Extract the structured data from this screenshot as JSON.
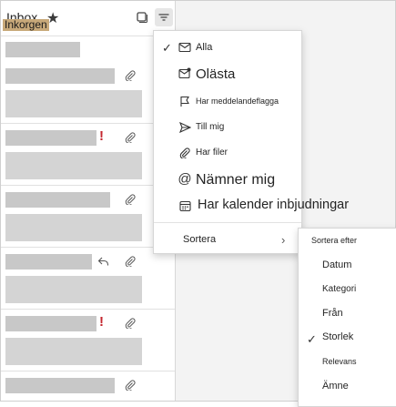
{
  "header": {
    "title": "Inbox",
    "title_overlay": "Inkorgen"
  },
  "filter_menu": {
    "items": [
      {
        "label": "Alla",
        "icon": "mail-icon",
        "checked": true
      },
      {
        "label": "Olästa",
        "icon": "unread-mail-icon",
        "checked": false
      },
      {
        "label": "Har meddelandeflagga",
        "icon": "flag-icon",
        "checked": false
      },
      {
        "label": "Till mig",
        "icon": "send-arrow-icon",
        "checked": false
      },
      {
        "label": "Har filer",
        "icon": "paperclip-icon",
        "checked": false
      },
      {
        "label": "Nämner mig",
        "icon": "at-sign-icon",
        "checked": false
      },
      {
        "label": "Har kalender inbjudningar",
        "icon": "calendar-icon",
        "checked": false
      }
    ],
    "sort_label": "Sortera"
  },
  "sort_submenu": {
    "header": "Sortera efter",
    "items": [
      {
        "label": "Datum",
        "checked": false
      },
      {
        "label": "Kategori",
        "checked": false
      },
      {
        "label": "Från",
        "checked": false
      },
      {
        "label": "Storlek",
        "checked": true
      },
      {
        "label": "Relevans",
        "checked": false
      },
      {
        "label": "Ämne",
        "checked": false
      }
    ]
  },
  "mail_items": [
    {
      "flagged": false,
      "replied": false,
      "attachment": true
    },
    {
      "flagged": true,
      "replied": false,
      "attachment": true
    },
    {
      "flagged": false,
      "replied": false,
      "attachment": true
    },
    {
      "flagged": false,
      "replied": true,
      "attachment": true
    },
    {
      "flagged": true,
      "replied": false,
      "attachment": true
    },
    {
      "flagged": false,
      "replied": false,
      "attachment": true
    }
  ],
  "colors": {
    "flag": "#c4262e",
    "title_highlight": "#c8a97a"
  }
}
